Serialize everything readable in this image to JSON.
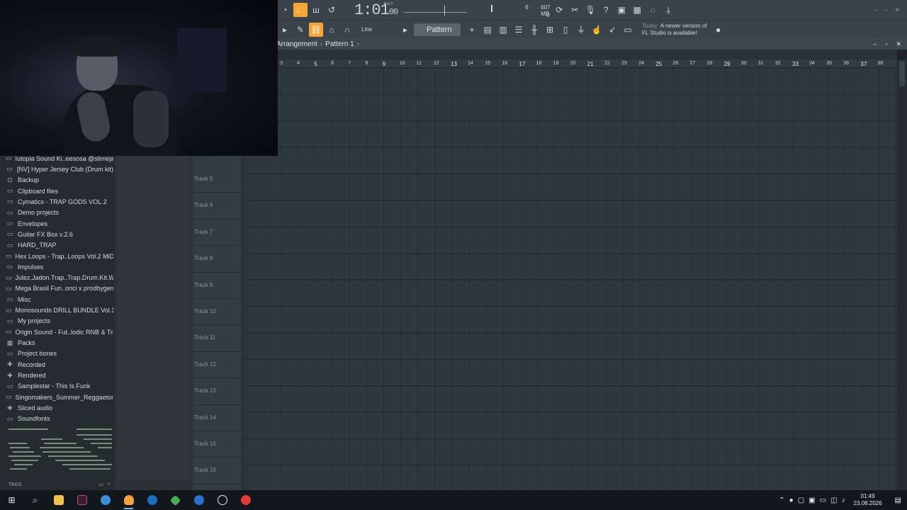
{
  "toolbar": {
    "song_time": "1:01",
    "song_time_sub": "00",
    "bst_label": "B:S:T",
    "cpu_value": "6",
    "memory": "607 MB",
    "polyphony": "0",
    "snap_mode": "Line",
    "pattern_name": "Pattern 1",
    "news_today": "Today",
    "news_text_1": "A newer version of",
    "news_text_2": "FL Studio is available!"
  },
  "breadcrumb": {
    "playlist": "Arrangement",
    "pattern": "Pattern 1"
  },
  "ruler": [
    "3",
    "4",
    "5",
    "6",
    "7",
    "8",
    "9",
    "10",
    "11",
    "12",
    "13",
    "14",
    "15",
    "16",
    "17",
    "18",
    "19",
    "20",
    "21",
    "22",
    "23",
    "24",
    "25",
    "26",
    "27",
    "28",
    "29",
    "30",
    "31",
    "32",
    "33",
    "34",
    "35",
    "36",
    "37",
    "38"
  ],
  "tracks": [
    "Track 5",
    "Track 6",
    "Track 7",
    "Track 8",
    "Track 9",
    "Track 10",
    "Track 11",
    "Track 12",
    "Track 13",
    "Track 14",
    "Track 15",
    "Track 16"
  ],
  "browser": {
    "items": [
      {
        "label": "Iutopia Sound Ki..eesosa @slimejax",
        "icon": "folder-icon"
      },
      {
        "label": "[NV] Hyper Jersey Club (Drum kit)",
        "icon": "folder-icon"
      },
      {
        "label": "Backup",
        "icon": "backup-folder-icon"
      },
      {
        "label": "Clipboard files",
        "icon": "folder-icon"
      },
      {
        "label": "Cymatics - TRAP GODS VOL.2",
        "icon": "folder-icon"
      },
      {
        "label": "Demo projects",
        "icon": "folder-icon"
      },
      {
        "label": "Envelopes",
        "icon": "folder-icon"
      },
      {
        "label": "Guitar FX Box v.2.6",
        "icon": "folder-icon"
      },
      {
        "label": "HARD_TRAP",
        "icon": "folder-icon"
      },
      {
        "label": "Hex Loops - Trap..Loops Vol.2 MiDi",
        "icon": "folder-icon"
      },
      {
        "label": "Impulses",
        "icon": "folder-icon"
      },
      {
        "label": "Julez.Jadon.Trap..Trap.Drum.Kit.WAV",
        "icon": "folder-icon"
      },
      {
        "label": "Mega Brasil Fun..onci x prodbygen)",
        "icon": "folder-icon"
      },
      {
        "label": "Misc",
        "icon": "folder-icon"
      },
      {
        "label": "Monosounds DRILL BUNDLE Vol.1",
        "icon": "folder-icon"
      },
      {
        "label": "My projects",
        "icon": "folder-icon"
      },
      {
        "label": "Origin Sound - Fut..lodic RNB & Trap",
        "icon": "folder-icon"
      },
      {
        "label": "Packs",
        "icon": "packs-icon"
      },
      {
        "label": "Project bones",
        "icon": "folder-icon"
      },
      {
        "label": "Recorded",
        "icon": "plus-folder-icon"
      },
      {
        "label": "Rendered",
        "icon": "plus-folder-icon"
      },
      {
        "label": "Samplestar - This Is Funk",
        "icon": "folder-icon"
      },
      {
        "label": "Singomakers_Summer_Reggaeton",
        "icon": "folder-icon"
      },
      {
        "label": "Sliced audio",
        "icon": "plus-folder-icon"
      },
      {
        "label": "Soundfonts",
        "icon": "folder-icon"
      }
    ],
    "tags_label": "TAGS"
  },
  "taskbar": {
    "time": "01:49",
    "date": "23.08.2026"
  },
  "colors": {
    "accent": "#f3a53a",
    "track_led": "#7fcf4a",
    "grid_bg": "#2f383d",
    "toolbar_bg": "#394349"
  }
}
